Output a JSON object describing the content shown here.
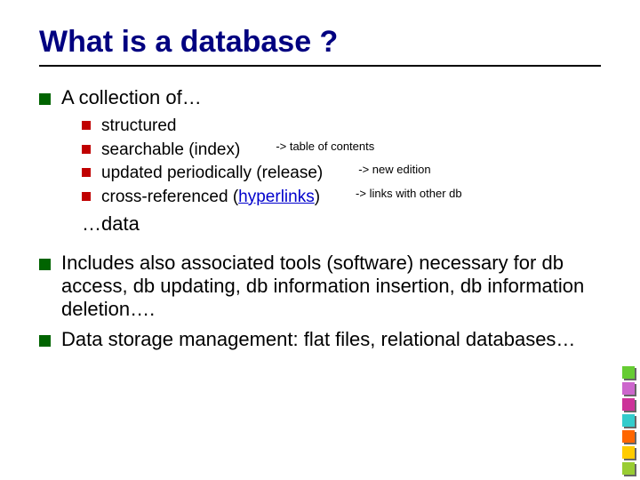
{
  "title": "What is a database ?",
  "bullets": {
    "collection_lead": "A collection of…",
    "sub": {
      "structured": "structured",
      "searchable": "searchable (index)",
      "updated": "updated periodically (release)",
      "crossref_pre": "cross-referenced (",
      "crossref_link": "hyperlinks",
      "crossref_post": ")"
    },
    "annot": {
      "searchable": "-> table of contents",
      "updated": "-> new edition",
      "crossref": "-> links with other db"
    },
    "data_trail": "…data",
    "includes": "Includes also associated tools (software) necessary for db access, db updating, db information insertion, db information deletion….",
    "storage": "Data storage management: flat files, relational databases…"
  },
  "corner_colors": [
    "#66cc33",
    "#cc66cc",
    "#cc3399",
    "#33cccc",
    "#ff6600",
    "#ffcc00",
    "#99cc33"
  ]
}
